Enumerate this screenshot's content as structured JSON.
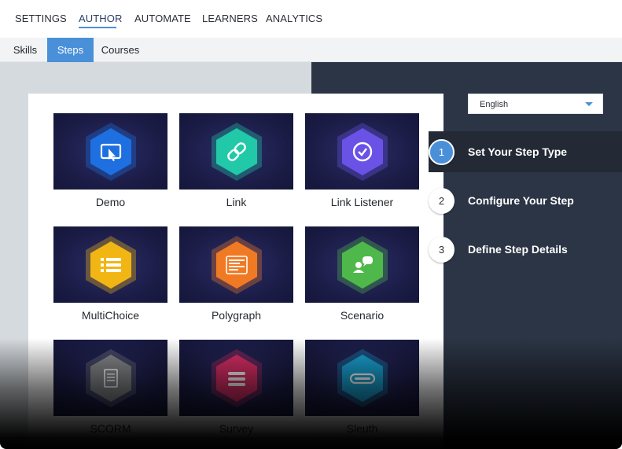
{
  "topnav": {
    "items": [
      "SETTINGS",
      "AUTHOR",
      "AUTOMATE",
      "LEARNERS",
      "ANALYTICS"
    ],
    "active": "AUTHOR"
  },
  "subtabs": {
    "items": [
      "Skills",
      "Steps",
      "Courses"
    ],
    "active": "Steps"
  },
  "step_types": [
    {
      "label": "Demo",
      "icon": "cursor-screen-icon",
      "color": "#1e6fe0"
    },
    {
      "label": "Link",
      "icon": "chain-link-icon",
      "color": "#22c9a8"
    },
    {
      "label": "Link Listener",
      "icon": "check-circle-icon",
      "color": "#6a52e6"
    },
    {
      "label": "MultiChoice",
      "icon": "list-icon",
      "color": "#f2b614"
    },
    {
      "label": "Polygraph",
      "icon": "document-lines-icon",
      "color": "#f07a24"
    },
    {
      "label": "Scenario",
      "icon": "chat-person-icon",
      "color": "#4fb84a"
    },
    {
      "label": "SCORM",
      "icon": "page-icon",
      "color": "#8a8c90"
    },
    {
      "label": "Survey",
      "icon": "bars-icon",
      "color": "#e0306a"
    },
    {
      "label": "Sleuth",
      "icon": "capsule-icon",
      "color": "#1aa6d8"
    }
  ],
  "language": {
    "value": "English"
  },
  "wizard_steps": [
    {
      "number": "1",
      "label": "Set Your Step Type",
      "active": true
    },
    {
      "number": "2",
      "label": "Configure Your Step",
      "active": false
    },
    {
      "number": "3",
      "label": "Define Step Details",
      "active": false
    }
  ],
  "colors": {
    "accent": "#4a90d9",
    "dark_panel": "#2c3545"
  }
}
